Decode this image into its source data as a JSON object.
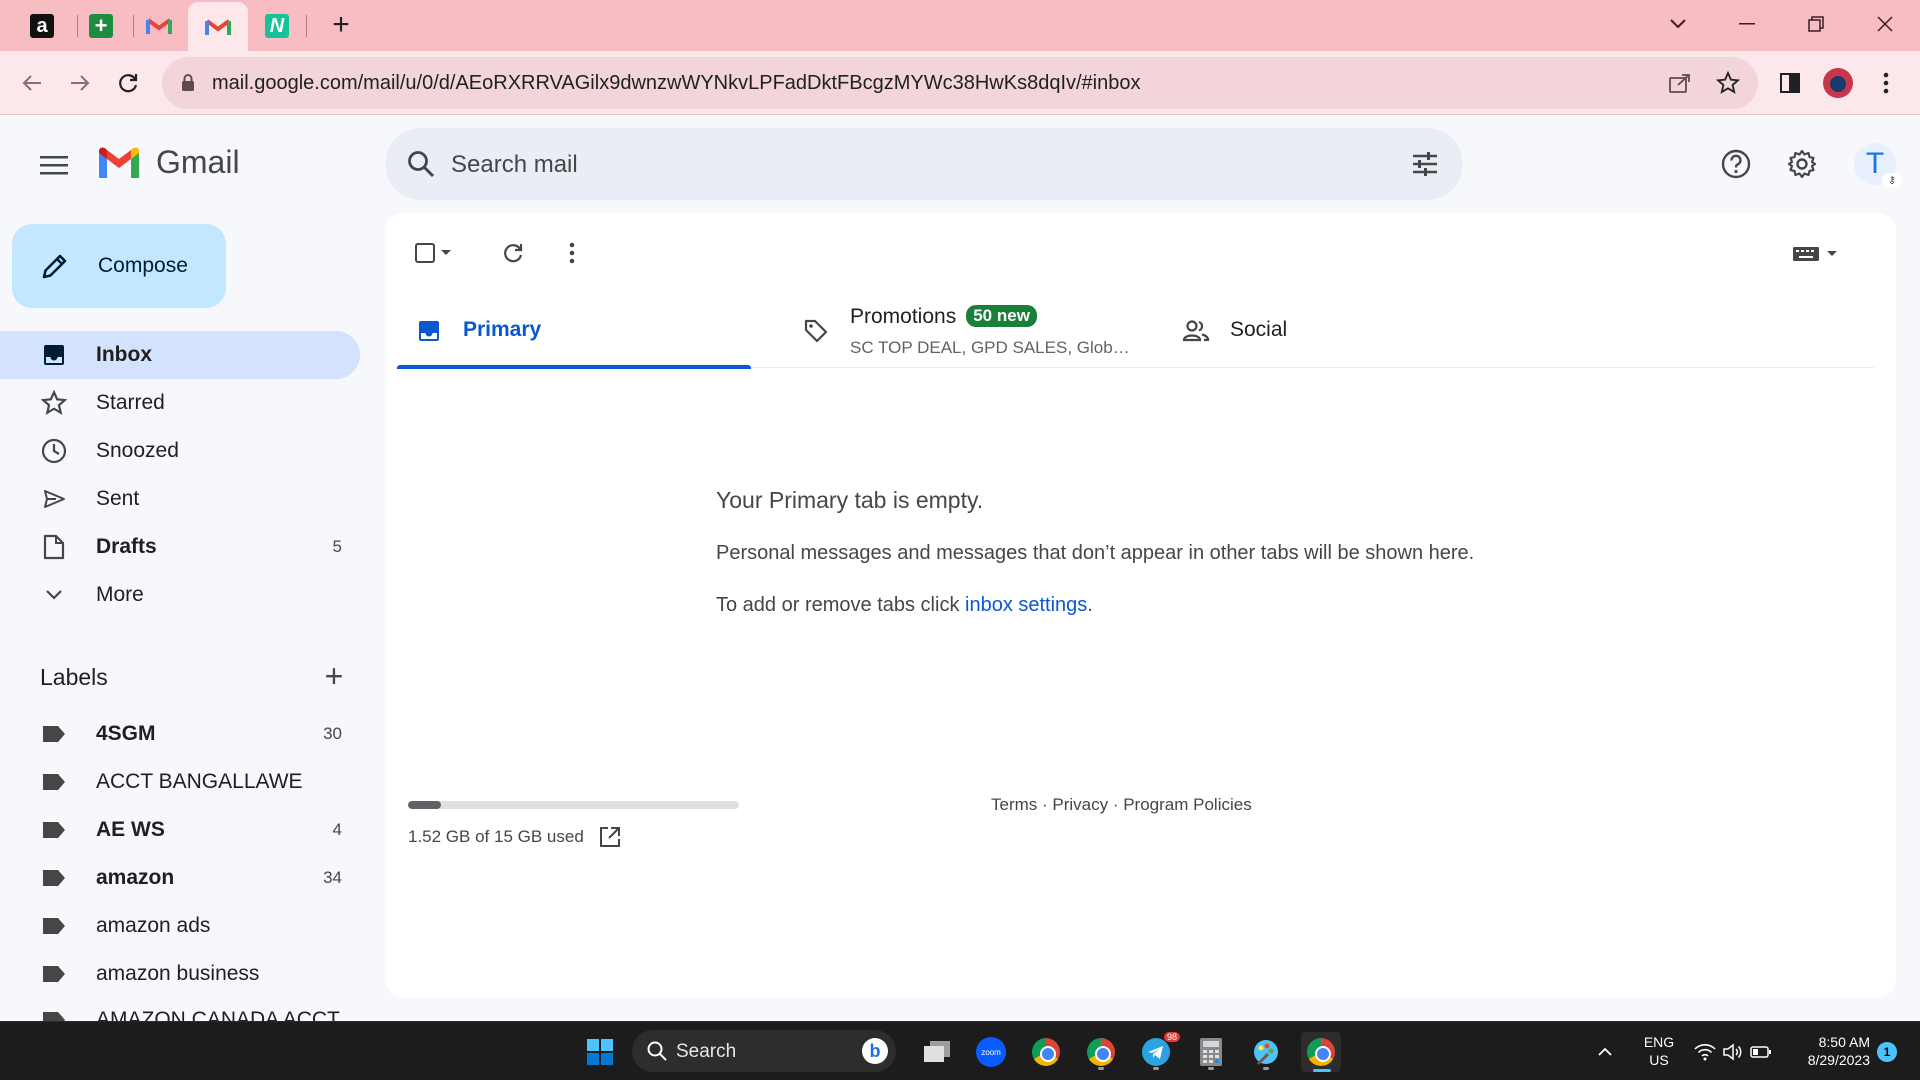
{
  "browser": {
    "url": "mail.google.com/mail/u/0/d/AEoRXRRVAGilx9dwnzwWYNkvLPFadDktFBcgzMYWc38HwKs8dqIv/#inbox",
    "tabs": [
      {
        "icon": "amazon-favicon",
        "glyph": "a"
      },
      {
        "icon": "google-sheets-favicon",
        "glyph": "+"
      },
      {
        "icon": "gmail-favicon",
        "glyph": "M"
      },
      {
        "icon": "gmail-favicon",
        "glyph": "M",
        "active": true
      },
      {
        "icon": "grammarly-favicon",
        "glyph": "N"
      }
    ]
  },
  "gmail": {
    "logo_text": "Gmail",
    "search_placeholder": "Search mail",
    "avatar_initial": "T"
  },
  "sidebar": {
    "compose_label": "Compose",
    "items": [
      {
        "label": "Inbox",
        "count": "",
        "icon": "inbox-icon",
        "active": true
      },
      {
        "label": "Starred",
        "count": "",
        "icon": "star-icon"
      },
      {
        "label": "Snoozed",
        "count": "",
        "icon": "clock-icon"
      },
      {
        "label": "Sent",
        "count": "",
        "icon": "send-icon"
      },
      {
        "label": "Drafts",
        "count": "5",
        "icon": "draft-icon"
      },
      {
        "label": "More",
        "count": "",
        "icon": "chevron-down-icon"
      }
    ],
    "labels_title": "Labels",
    "labels": [
      {
        "label": "4SGM",
        "count": "30"
      },
      {
        "label": "ACCT BANGALLAWE",
        "count": ""
      },
      {
        "label": "AE WS",
        "count": "4"
      },
      {
        "label": "amazon",
        "count": "34"
      },
      {
        "label": "amazon ads",
        "count": ""
      },
      {
        "label": "amazon business",
        "count": ""
      },
      {
        "label": "AMAZON CANADA ACCT",
        "count": ""
      }
    ]
  },
  "main": {
    "tabs": {
      "primary": "Primary",
      "promotions": "Promotions",
      "promotions_badge": "50 new",
      "promotions_snippet": "SC TOP DEAL, GPD SALES, Glob…",
      "social": "Social"
    },
    "empty_title": "Your Primary tab is empty.",
    "empty_line1": "Personal messages and messages that don’t appear in other tabs will be shown here.",
    "empty_line2_prefix": "To add or remove tabs click ",
    "empty_link": "inbox settings",
    "empty_line2_suffix": ".",
    "storage_text": "1.52 GB of 15 GB used",
    "storage_used_fraction": 0.1,
    "footer_links": "Terms · Privacy · Program Policies"
  },
  "taskbar": {
    "search_label": "Search",
    "lang_top": "ENG",
    "lang_bottom": "US",
    "time": "8:50 AM",
    "date": "8/29/2023",
    "telegram_badge": "98",
    "notification_count": "1"
  },
  "colors": {
    "tabstrip": "#f8bcc3",
    "toolbar": "#fce8ea",
    "accent": "#0b57d0",
    "compose": "#c2e7ff",
    "nav_active": "#d3e3fd",
    "promo_badge": "#188038"
  }
}
